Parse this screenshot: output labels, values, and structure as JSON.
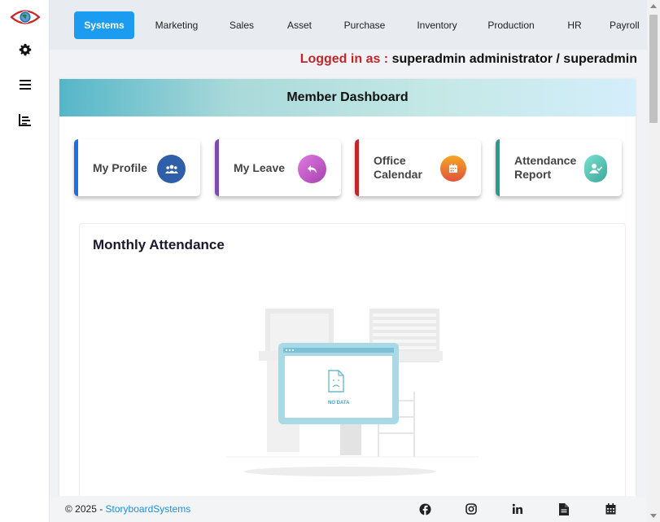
{
  "sidebar": {
    "logo_icon": "eye-globe-logo",
    "items": [
      {
        "icon": "gear-icon"
      },
      {
        "icon": "menu-icon"
      },
      {
        "icon": "bar-chart-icon"
      }
    ]
  },
  "nav": {
    "tabs": [
      {
        "label": "Systems",
        "active": true
      },
      {
        "label": "Marketing"
      },
      {
        "label": "Sales"
      },
      {
        "label": "Asset"
      },
      {
        "label": "Purchase"
      },
      {
        "label": "Inventory"
      },
      {
        "label": "Production"
      },
      {
        "label": "HR"
      },
      {
        "label": "Payroll"
      }
    ]
  },
  "session": {
    "logged_in_label": "Logged in as :",
    "user": "superadmin administrator / superadmin"
  },
  "dashboard": {
    "title": "Member Dashboard",
    "cards": [
      {
        "label": "My Profile",
        "icon": "users-icon",
        "accent": "#1d6fe0"
      },
      {
        "label": "My Leave",
        "icon": "reply-arrow-icon",
        "accent": "#7e4cb0"
      },
      {
        "label": "Office Calendar",
        "icon": "calendar-icon",
        "accent": "#c0272d"
      },
      {
        "label": "Attendance Report",
        "icon": "user-check-icon",
        "accent": "#2a9a8a"
      }
    ],
    "attendance": {
      "title": "Monthly Attendance",
      "empty_text": "NO DATA"
    }
  },
  "footer": {
    "copyright": "© 2025 - ",
    "brand": "StoryboardSystems",
    "icons": [
      "facebook-icon",
      "instagram-icon",
      "linkedin-icon",
      "document-icon",
      "calendar-icon"
    ]
  },
  "colors": {
    "primary": "#1b9cf0",
    "logged_label": "#c0272d"
  }
}
